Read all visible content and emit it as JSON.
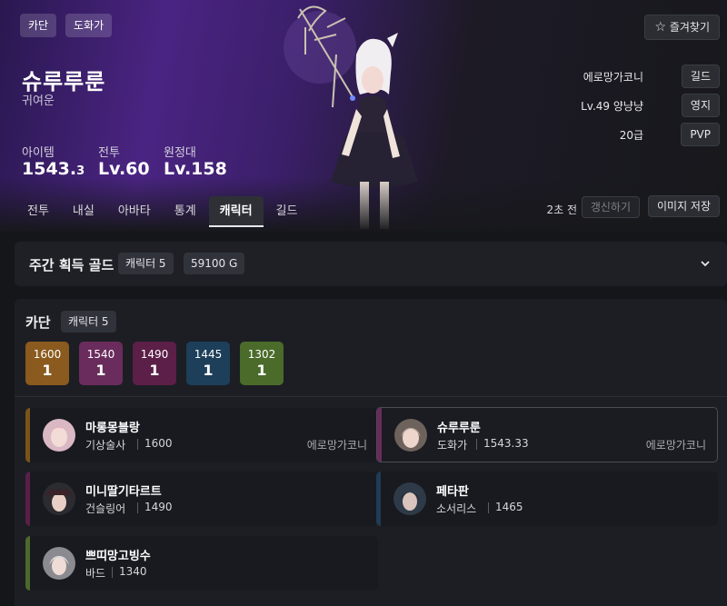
{
  "header": {
    "tags": [
      "카단",
      "도화가"
    ],
    "favorite_label": "즐겨찾기",
    "character_name": "슈루루룬",
    "character_title": "귀여운",
    "stats": [
      {
        "label": "아이템",
        "value": "1543.",
        "value_small": "3"
      },
      {
        "label": "전투",
        "value": "Lv.60"
      },
      {
        "label": "원정대",
        "value": "Lv.158"
      }
    ],
    "info_rows": [
      {
        "text": "에로망가코니",
        "button": "길드"
      },
      {
        "text": "Lv.49 양냥냥",
        "button": "영지"
      },
      {
        "text": "20급",
        "button": "PVP"
      }
    ],
    "tabs": [
      "전투",
      "내실",
      "아바타",
      "통계",
      "캐릭터",
      "길드"
    ],
    "active_tab": "캐릭터",
    "updated_ago": "2초 전",
    "refresh_label": "갱신하기",
    "save_image_label": "이미지 저장"
  },
  "gold": {
    "title": "주간 획득 골드",
    "character_count": "캐릭터 5",
    "amount": "59100 G"
  },
  "server": {
    "name": "카단",
    "character_count": "캐릭터 5",
    "level_summary": [
      {
        "level": "1600",
        "count": "1",
        "color": "#8a5a1e"
      },
      {
        "level": "1540",
        "count": "1",
        "color": "#6a2c5c"
      },
      {
        "level": "1490",
        "count": "1",
        "color": "#5c1f48"
      },
      {
        "level": "1445",
        "count": "1",
        "color": "#1d3f5a"
      },
      {
        "level": "1302",
        "count": "1",
        "color": "#4a6b2a"
      }
    ],
    "characters": [
      {
        "name": "마롱몽블랑",
        "class": "기상술사",
        "level": "1600",
        "guild": "에로망가코니",
        "stripe": "#7a5418",
        "selected": false
      },
      {
        "name": "슈루루룬",
        "class": "도화가",
        "level": "1543.33",
        "guild": "에로망가코니",
        "stripe": "#6b2a5c",
        "selected": true
      },
      {
        "name": "미니딸기타르트",
        "class": "건슬링어",
        "level": "1490",
        "guild": "",
        "stripe": "#5a1f48",
        "selected": false
      },
      {
        "name": "페타판",
        "class": "소서리스",
        "level": "1465",
        "guild": "",
        "stripe": "#1e3c55",
        "selected": false
      },
      {
        "name": "쁘띠망고빙수",
        "class": "바드",
        "level": "1340",
        "guild": "",
        "stripe": "#4c6a2c",
        "selected": false
      }
    ]
  }
}
